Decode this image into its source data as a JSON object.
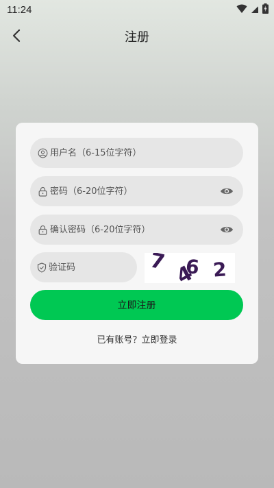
{
  "status_bar": {
    "time": "11:24"
  },
  "header": {
    "title": "注册"
  },
  "form": {
    "username_placeholder": "用户名（6-15位字符）",
    "password_placeholder": "密码（6-20位字符）",
    "confirm_password_placeholder": "确认密码（6-20位字符）",
    "captcha_placeholder": "验证码",
    "captcha_code": [
      "7",
      "4",
      "6",
      "2"
    ],
    "register_label": "立即注册",
    "login_link": "已有账号？立即登录"
  },
  "colors": {
    "primary_button": "#00c853",
    "captcha_text": "#3a1a55"
  }
}
